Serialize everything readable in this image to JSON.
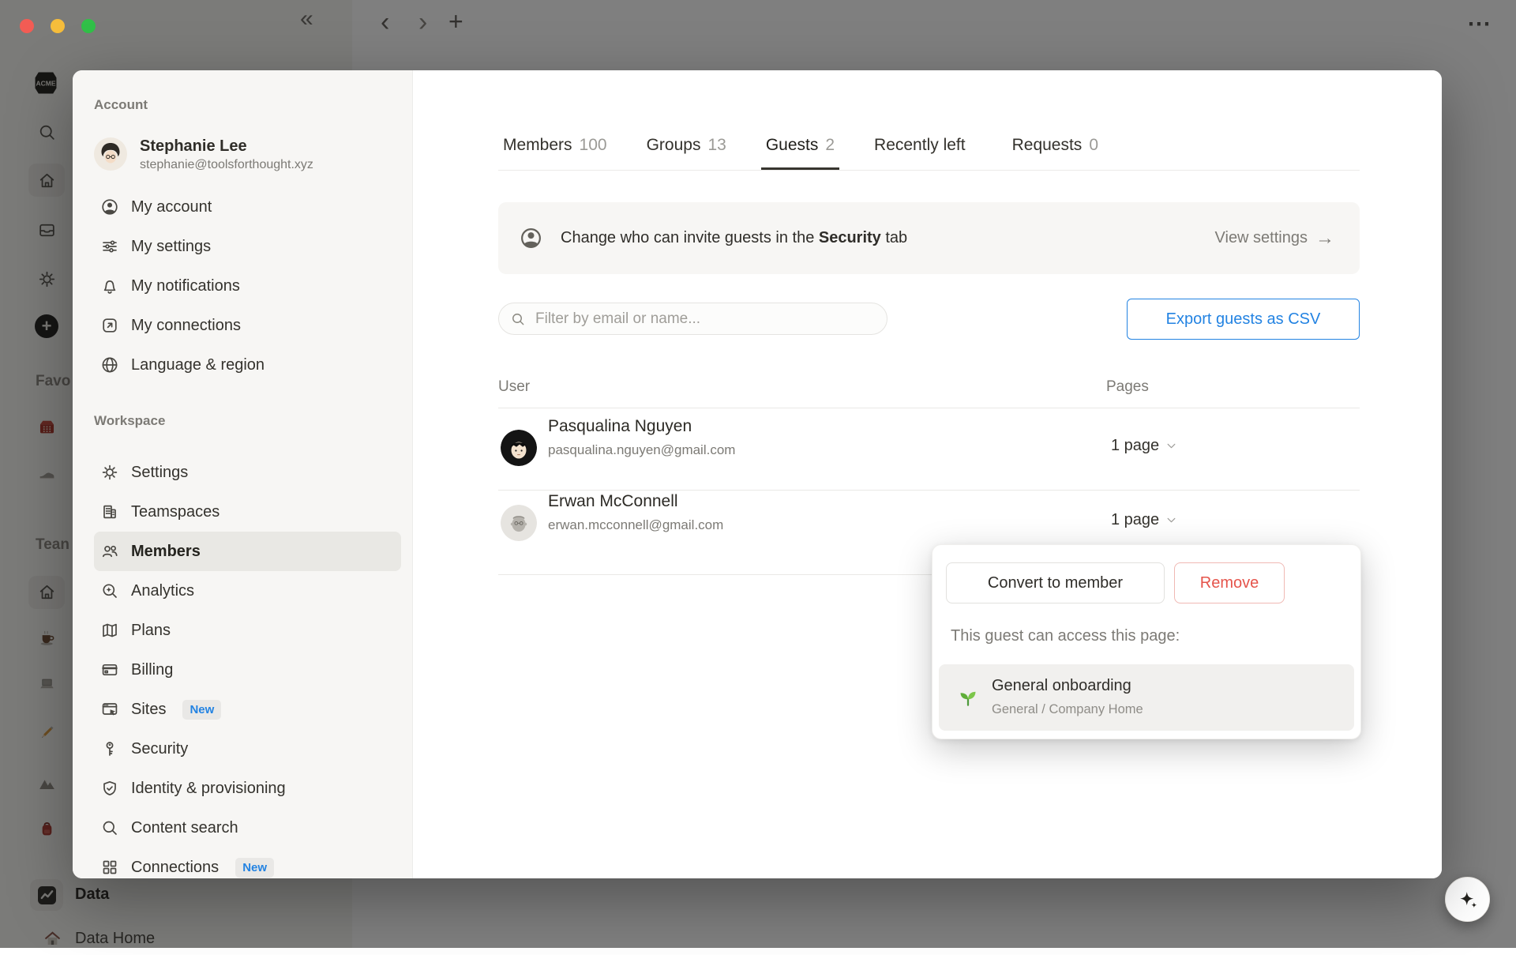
{
  "chrome": {
    "nav": {
      "collapse": "«",
      "back": "‹",
      "forward": "›",
      "new_tab": "+",
      "more": "⋯"
    }
  },
  "app_rail": {
    "logo_text": "ACME",
    "favorites_label": "Favo",
    "teamspaces_label": "Tean",
    "data_label": "Data",
    "data_home_label": "Data Home"
  },
  "modal": {
    "sidebar": {
      "account_heading": "Account",
      "user": {
        "name": "Stephanie Lee",
        "email": "stephanie@toolsforthought.xyz"
      },
      "account_items": [
        {
          "label": "My account",
          "icon": "person-circle-icon"
        },
        {
          "label": "My settings",
          "icon": "sliders-icon"
        },
        {
          "label": "My notifications",
          "icon": "bell-icon"
        },
        {
          "label": "My connections",
          "icon": "arrow-up-right-box-icon"
        },
        {
          "label": "Language & region",
          "icon": "globe-icon"
        }
      ],
      "workspace_heading": "Workspace",
      "workspace_items": [
        {
          "label": "Settings",
          "icon": "gear-icon"
        },
        {
          "label": "Teamspaces",
          "icon": "building-icon"
        },
        {
          "label": "Members",
          "icon": "people-icon",
          "active": true
        },
        {
          "label": "Analytics",
          "icon": "magnifier-sparkle-icon"
        },
        {
          "label": "Plans",
          "icon": "map-icon"
        },
        {
          "label": "Billing",
          "icon": "credit-card-icon"
        },
        {
          "label": "Sites",
          "icon": "browser-cursor-icon",
          "badge": "New"
        },
        {
          "label": "Security",
          "icon": "key-icon"
        },
        {
          "label": "Identity & provisioning",
          "icon": "shield-check-icon"
        },
        {
          "label": "Content search",
          "icon": "magnifier-icon"
        },
        {
          "label": "Connections",
          "icon": "grid-icon",
          "badge": "New"
        }
      ]
    },
    "main": {
      "tabs": [
        {
          "label": "Members",
          "count": "100"
        },
        {
          "label": "Groups",
          "count": "13"
        },
        {
          "label": "Guests",
          "count": "2",
          "active": true
        },
        {
          "label": "Recently left",
          "count": ""
        },
        {
          "label": "Requests",
          "count": "0"
        }
      ],
      "banner": {
        "prefix": "Change who can invite guests in the ",
        "bold": "Security",
        "suffix": " tab",
        "action": "View settings",
        "arrow": "→"
      },
      "filter": {
        "placeholder": "Filter by email or name..."
      },
      "export_button": "Export guests as CSV",
      "table": {
        "columns": {
          "user": "User",
          "pages": "Pages"
        },
        "rows": [
          {
            "name": "Pasqualina Nguyen",
            "email": "pasqualina.nguyen@gmail.com",
            "pages": "1 page"
          },
          {
            "name": "Erwan McConnell",
            "email": "erwan.mcconnell@gmail.com",
            "pages": "1 page"
          }
        ]
      },
      "popover": {
        "convert_button": "Convert to member",
        "remove_button": "Remove",
        "caption": "This guest can access this page:",
        "page": {
          "title": "General onboarding",
          "path": "General / Company Home"
        }
      }
    }
  },
  "colors": {
    "accent_blue": "#2383e2",
    "danger_red": "#eb5757",
    "text_primary": "#37352f",
    "text_secondary": "#787774",
    "modal_sidebar_bg": "#f7f6f4",
    "selected_item_bg": "#e9e8e4",
    "divider": "#e9e8e6"
  }
}
